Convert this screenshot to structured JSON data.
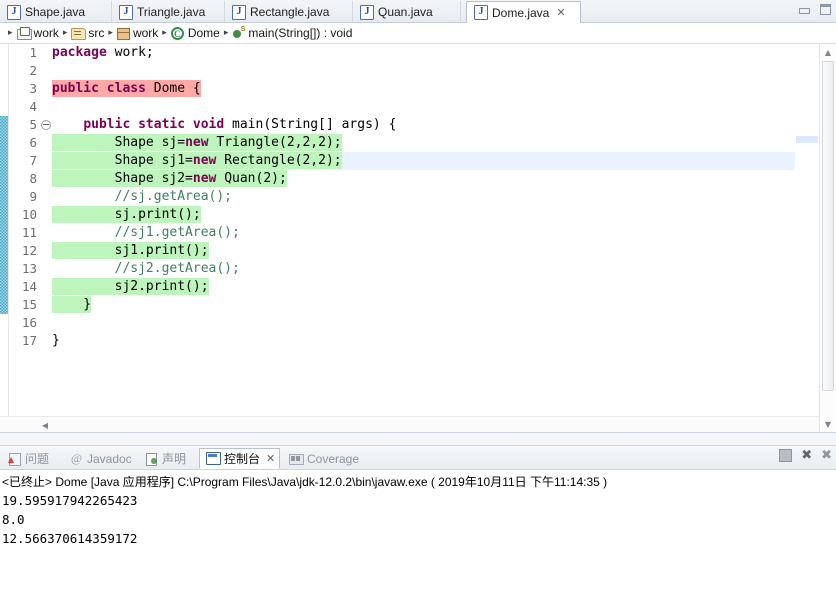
{
  "window": {
    "minimize_label": "Minimize",
    "maximize_label": "Maximize"
  },
  "editor_tabs": [
    {
      "label": "Shape.java",
      "icon": "java-file-icon",
      "active": false
    },
    {
      "label": "Triangle.java",
      "icon": "java-file-icon",
      "active": false
    },
    {
      "label": "Rectangle.java",
      "icon": "java-file-icon",
      "active": false
    },
    {
      "label": "Quan.java",
      "icon": "java-file-icon",
      "active": false
    },
    {
      "label": "Dome.java",
      "icon": "java-file-icon",
      "active": true,
      "close": "✕"
    }
  ],
  "breadcrumb": {
    "separator": "▸",
    "items": [
      {
        "label": "work",
        "icon": "project-folder-icon"
      },
      {
        "label": "src",
        "icon": "source-folder-icon"
      },
      {
        "label": "work",
        "icon": "package-icon"
      },
      {
        "label": "Dome",
        "icon": "class-icon"
      },
      {
        "label": "main(String[]) : void",
        "icon": "method-icon"
      }
    ]
  },
  "code": {
    "lines": [
      {
        "n": "1",
        "fold": false,
        "changed": false,
        "cursor": false,
        "segments": [
          {
            "t": "package ",
            "c": "kw",
            "hl": "none"
          },
          {
            "t": "work;",
            "c": "plain",
            "hl": "none"
          }
        ]
      },
      {
        "n": "2",
        "fold": false,
        "changed": false,
        "cursor": false,
        "segments": []
      },
      {
        "n": "3",
        "fold": false,
        "changed": false,
        "cursor": false,
        "segments": [
          {
            "t": "public class ",
            "c": "kw",
            "hl": "pink"
          },
          {
            "t": "Dome {",
            "c": "plain",
            "hl": "pink"
          }
        ]
      },
      {
        "n": "4",
        "fold": false,
        "changed": false,
        "cursor": false,
        "segments": []
      },
      {
        "n": "5",
        "fold": true,
        "changed": true,
        "cursor": false,
        "segments": [
          {
            "t": "    ",
            "c": "plain",
            "hl": "none"
          },
          {
            "t": "public static void ",
            "c": "kw",
            "hl": "none"
          },
          {
            "t": "main(String[] args) {",
            "c": "plain",
            "hl": "none"
          }
        ]
      },
      {
        "n": "6",
        "fold": false,
        "changed": true,
        "cursor": false,
        "segments": [
          {
            "t": "        Shape sj=",
            "c": "plain",
            "hl": "green"
          },
          {
            "t": "new ",
            "c": "kw",
            "hl": "green"
          },
          {
            "t": "Triangle(2,2,2);",
            "c": "plain",
            "hl": "green"
          }
        ]
      },
      {
        "n": "7",
        "fold": false,
        "changed": true,
        "cursor": true,
        "segments": [
          {
            "t": "        Shape sj1=",
            "c": "plain",
            "hl": "green"
          },
          {
            "t": "new ",
            "c": "kw",
            "hl": "green"
          },
          {
            "t": "Rectangle(2,2);",
            "c": "plain",
            "hl": "green"
          }
        ]
      },
      {
        "n": "8",
        "fold": false,
        "changed": true,
        "cursor": false,
        "segments": [
          {
            "t": "        Shape sj2=",
            "c": "plain",
            "hl": "green"
          },
          {
            "t": "new ",
            "c": "kw",
            "hl": "green"
          },
          {
            "t": "Quan(2);",
            "c": "plain",
            "hl": "green"
          }
        ]
      },
      {
        "n": "9",
        "fold": false,
        "changed": true,
        "cursor": false,
        "segments": [
          {
            "t": "        //sj.getArea();",
            "c": "cmt",
            "hl": "none"
          }
        ]
      },
      {
        "n": "10",
        "fold": false,
        "changed": true,
        "cursor": false,
        "segments": [
          {
            "t": "        sj.print();",
            "c": "plain",
            "hl": "green"
          }
        ]
      },
      {
        "n": "11",
        "fold": false,
        "changed": true,
        "cursor": false,
        "segments": [
          {
            "t": "        //sj1.getArea();",
            "c": "cmt",
            "hl": "none"
          }
        ]
      },
      {
        "n": "12",
        "fold": false,
        "changed": true,
        "cursor": false,
        "segments": [
          {
            "t": "        sj1.print();",
            "c": "plain",
            "hl": "green"
          }
        ]
      },
      {
        "n": "13",
        "fold": false,
        "changed": true,
        "cursor": false,
        "segments": [
          {
            "t": "        //sj2.getArea();",
            "c": "cmt",
            "hl": "none"
          }
        ]
      },
      {
        "n": "14",
        "fold": false,
        "changed": true,
        "cursor": false,
        "segments": [
          {
            "t": "        sj2.print();",
            "c": "plain",
            "hl": "green"
          }
        ]
      },
      {
        "n": "15",
        "fold": false,
        "changed": true,
        "cursor": false,
        "segments": [
          {
            "t": "    }",
            "c": "plain",
            "hl": "green"
          }
        ]
      },
      {
        "n": "16",
        "fold": false,
        "changed": false,
        "cursor": false,
        "segments": []
      },
      {
        "n": "17",
        "fold": false,
        "changed": false,
        "cursor": false,
        "segments": [
          {
            "t": "}",
            "c": "plain",
            "hl": "none"
          }
        ]
      }
    ]
  },
  "scrollbars": {
    "up_arrow": "▲",
    "down_arrow": "▼",
    "left_arrow": "◀"
  },
  "console_tabs": [
    {
      "label": "问题",
      "icon": "problems-icon",
      "active": false
    },
    {
      "label": "Javadoc",
      "icon": "javadoc-icon",
      "active": false
    },
    {
      "label": "声明",
      "icon": "declaration-icon",
      "active": false
    },
    {
      "label": "控制台",
      "icon": "console-icon",
      "active": true,
      "close": "✕"
    },
    {
      "label": "Coverage",
      "icon": "coverage-icon",
      "active": false
    }
  ],
  "console_toolbar": {
    "terminate_label": "Terminate",
    "remove_label": "✖",
    "remove_all_label": "✖"
  },
  "console": {
    "header": "<已终止> Dome [Java 应用程序] C:\\Program Files\\Java\\jdk-12.0.2\\bin\\javaw.exe ( 2019年10月11日 下午11:14:35 )",
    "output": [
      "19.595917942265423",
      "8.0",
      "12.566370614359172"
    ]
  },
  "colors": {
    "keyword": "#7f0055",
    "comment": "#3f7f5f",
    "search_highlight": "#ffa8a8",
    "occurrence_highlight": "#bdf5bd",
    "cursor_line": "#e9f2fd",
    "change_bar": "#3fa8c6"
  }
}
